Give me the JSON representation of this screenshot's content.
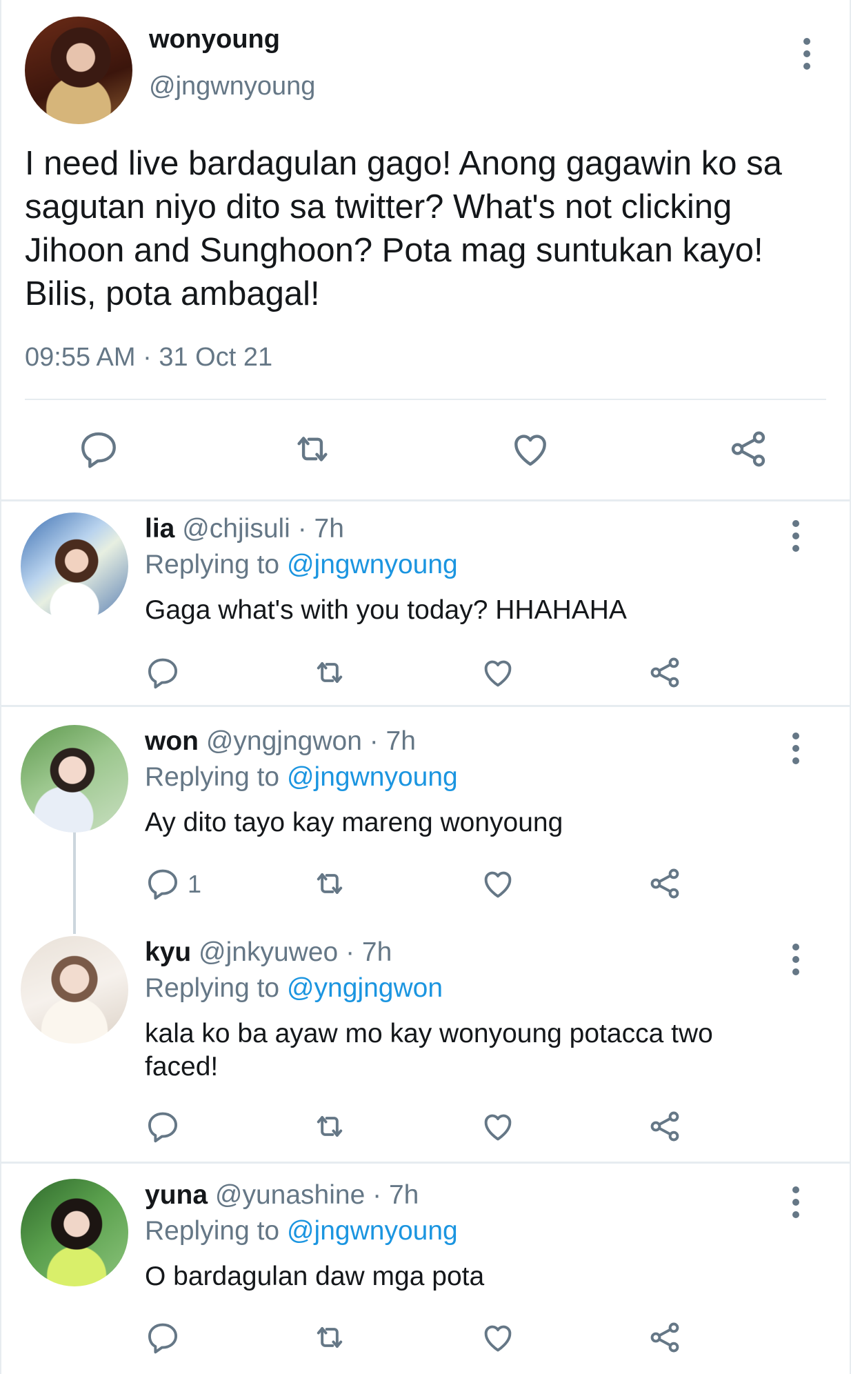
{
  "main_tweet": {
    "name": "wonyoung",
    "handle": "@jngwnyoung",
    "text": "I need live bardagulan gago! Anong gagawin ko sa sagutan niyo dito sa twitter? What's not clicking Jihoon and Sunghoon? Pota mag suntukan kayo! Bilis, pota ambagal!",
    "timestamp": "09:55 AM · 31 Oct 21",
    "actions": [
      "reply-icon",
      "retweet-icon",
      "like-icon",
      "share-icon"
    ]
  },
  "replies": [
    {
      "name": "lia",
      "handle": "@chjisuli",
      "age": "· 7h",
      "replying_prefix": "Replying to",
      "replying_to": "@jngwnyoung",
      "text": "Gaga what's with you today? HHAHAHA",
      "reply_count": ""
    },
    {
      "name": "won",
      "handle": "@yngjngwon",
      "age": "· 7h",
      "replying_prefix": "Replying to",
      "replying_to": "@jngwnyoung",
      "text": "Ay dito tayo kay mareng wonyoung",
      "reply_count": "1"
    },
    {
      "name": "kyu",
      "handle": "@jnkyuweo",
      "age": "· 7h",
      "replying_prefix": "Replying to",
      "replying_to": "@yngjngwon",
      "text": "kala ko ba ayaw mo kay wonyoung potacca two faced!",
      "reply_count": ""
    },
    {
      "name": "yuna",
      "handle": "@yunashine",
      "age": "· 7h",
      "replying_prefix": "Replying to",
      "replying_to": "@jngwnyoung",
      "text": "O bardagulan daw mga pota",
      "reply_count": ""
    }
  ],
  "colors": {
    "text": "#14171a",
    "secondary": "#657786",
    "link": "#1b95e0",
    "divider": "#e6ecf0"
  }
}
